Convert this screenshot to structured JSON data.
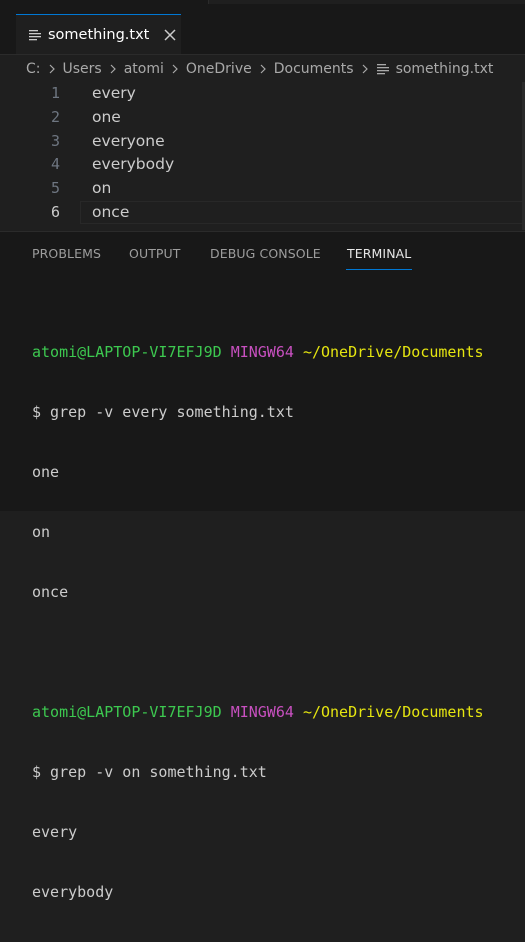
{
  "tab": {
    "label": "something.txt",
    "file_icon": "file-lines-icon",
    "close_icon": "close-icon"
  },
  "breadcrumb": {
    "items": [
      "C:",
      "Users",
      "atomi",
      "OneDrive",
      "Documents"
    ],
    "file": "something.txt"
  },
  "editor": {
    "lines": [
      {
        "number": "1",
        "text": "every"
      },
      {
        "number": "2",
        "text": "one"
      },
      {
        "number": "3",
        "text": "everyone"
      },
      {
        "number": "4",
        "text": "everybody"
      },
      {
        "number": "5",
        "text": "on"
      },
      {
        "number": "6",
        "text": "once"
      }
    ],
    "current_line": "6"
  },
  "panel": {
    "tabs": [
      {
        "label": "PROBLEMS",
        "active": false
      },
      {
        "label": "OUTPUT",
        "active": false
      },
      {
        "label": "DEBUG CONSOLE",
        "active": false
      },
      {
        "label": "TERMINAL",
        "active": true
      }
    ]
  },
  "terminal": {
    "prompt_user": "atomi@LAPTOP-VI7EFJ9D",
    "prompt_system": "MINGW64",
    "prompt_path": "~/OneDrive/Documents",
    "blocks": [
      {
        "command": "$ grep -v every something.txt",
        "output": [
          "one",
          "on",
          "once"
        ]
      },
      {
        "command": "$ grep -v on something.txt",
        "output": [
          "every",
          "everybody"
        ]
      }
    ]
  },
  "colors": {
    "accent": "#0078d4",
    "prompt_user": "#3dc950",
    "prompt_system": "#c850c0",
    "prompt_path": "#e5e510"
  }
}
